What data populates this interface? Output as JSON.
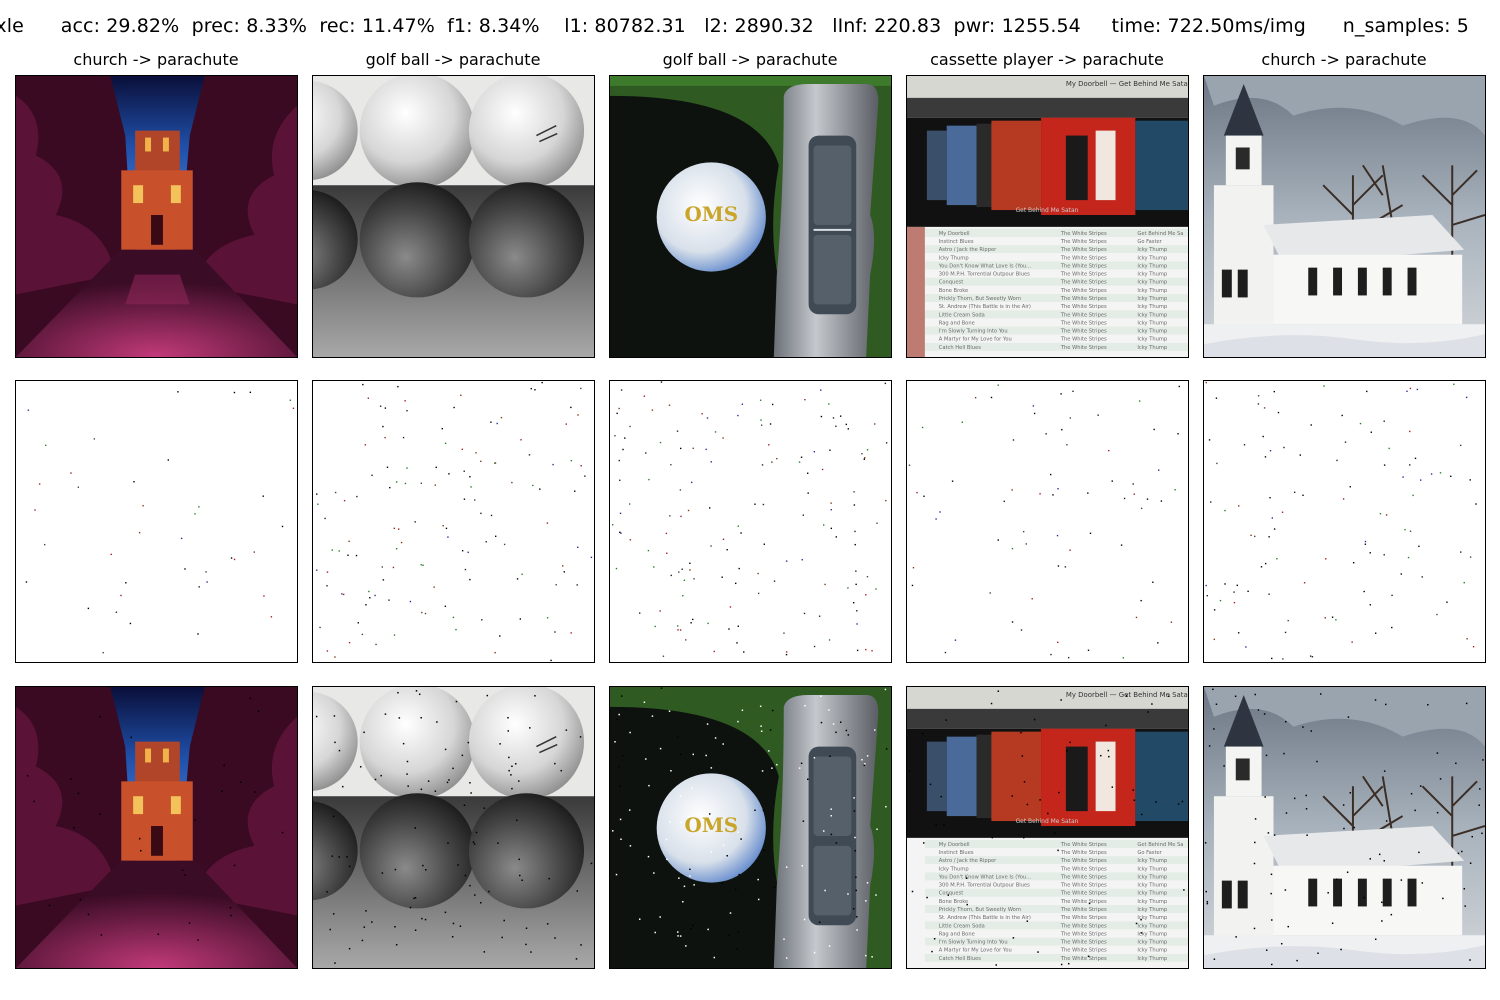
{
  "header": {
    "method": "ixle",
    "acc": "acc: 29.82%",
    "prec": "prec: 8.33%",
    "rec": "rec: 11.47%",
    "f1": "f1: 8.34%",
    "l1": "l1: 80782.31",
    "l2": "l2: 2890.32",
    "linf": "lInf: 220.83",
    "pwr": "pwr: 1255.54",
    "time": "time: 722.50ms/img",
    "n_samples": "n_samples: 5"
  },
  "columns": [
    {
      "title": "church -> parachute",
      "subject": "church-at-dusk"
    },
    {
      "title": "golf ball -> parachute",
      "subject": "golf-balls-reflection"
    },
    {
      "title": "golf ball -> parachute",
      "subject": "golf-ball-and-putter"
    },
    {
      "title": "cassette player -> parachute",
      "subject": "music-player-screenshot"
    },
    {
      "title": "church -> parachute",
      "subject": "white-church-in-snow"
    }
  ],
  "rows": [
    "original",
    "perturbation",
    "adversarial"
  ],
  "screen_text": {
    "now_playing": "My Doorbell — Get Behind Me Satan",
    "album": "Get Behind Me Satan",
    "tracks": [
      "My Doorbell",
      "Instinct Blues",
      "Astro / Jack the Ripper",
      "Icky Thump",
      "You Don't Know What Love Is (You...",
      "300 M.P.H. Torrential Outpour Blues",
      "Conquest",
      "Bone Broke",
      "Prickly Thorn, But Sweetly Worn",
      "St. Andrew (This Battle is in the Air)",
      "Little Cream Soda",
      "Rag and Bone",
      "I'm Slowly Turning Into You",
      "A Martyr for My Love for You",
      "Catch Hell Blues"
    ],
    "artist": "The White Stripes",
    "albums": [
      "Get Behind Me Sa",
      "Go Faster",
      "Icky Thump",
      "Icky Thump",
      "Icky Thump",
      "Icky Thump",
      "Icky Thump",
      "Icky Thump",
      "Icky Thump",
      "Icky Thump",
      "Icky Thump",
      "Icky Thump",
      "Icky Thump",
      "Icky Thump",
      "Icky Thump"
    ],
    "golf_ball_logo": "OMS"
  },
  "colors": {
    "background": "#ffffff",
    "church_sky": "#1f4fa8",
    "church_foliage": "#4a0f2a",
    "church_tower": "#d2532a"
  }
}
